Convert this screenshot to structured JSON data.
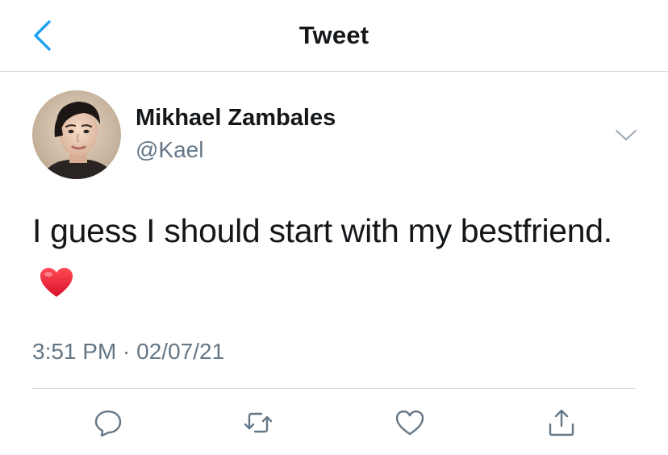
{
  "header": {
    "title": "Tweet",
    "back_icon": "chevron-left-icon",
    "accent_color": "#1da1f2"
  },
  "tweet": {
    "author": {
      "display_name": "Mikhael Zambales",
      "handle": "@Kael",
      "avatar": "profile-photo"
    },
    "more_icon": "chevron-down-icon",
    "text": "I guess I should start with my bestfriend.",
    "emoji": "red-heart",
    "timestamp": "3:51 PM · 02/07/21"
  },
  "actions": [
    {
      "name": "reply",
      "icon": "comment-icon"
    },
    {
      "name": "retweet",
      "icon": "retweet-icon"
    },
    {
      "name": "like",
      "icon": "heart-outline-icon"
    },
    {
      "name": "share",
      "icon": "share-icon"
    }
  ],
  "colors": {
    "text": "#14171a",
    "secondary": "#657786",
    "divider": "#d4d9de",
    "icon": "#657786",
    "emoji_heart": "#e0245e"
  }
}
